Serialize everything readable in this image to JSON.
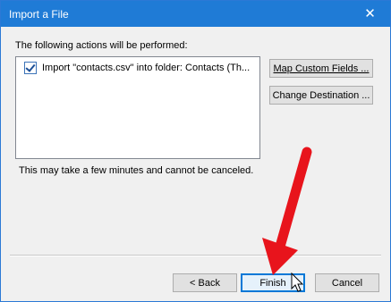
{
  "window": {
    "title": "Import a File",
    "close_icon": "close-icon"
  },
  "actions_heading": "The following actions will be performed:",
  "actions": [
    {
      "label": "Import \"contacts.csv\" into folder: Contacts (Th...",
      "checked": true
    }
  ],
  "side_buttons": {
    "map_custom_fields": "Map Custom Fields ...",
    "change_destination": "Change Destination ..."
  },
  "notice": "This may take a few minutes and cannot be canceled.",
  "footer_buttons": {
    "back": "< Back",
    "finish": "Finish",
    "cancel": "Cancel"
  },
  "annotation": {
    "arrow_color": "#e8141c",
    "arrow_icon": "red-arrow"
  },
  "colors": {
    "titlebar": "#1f7bd6",
    "dialog_bg": "#f0f0f0"
  }
}
